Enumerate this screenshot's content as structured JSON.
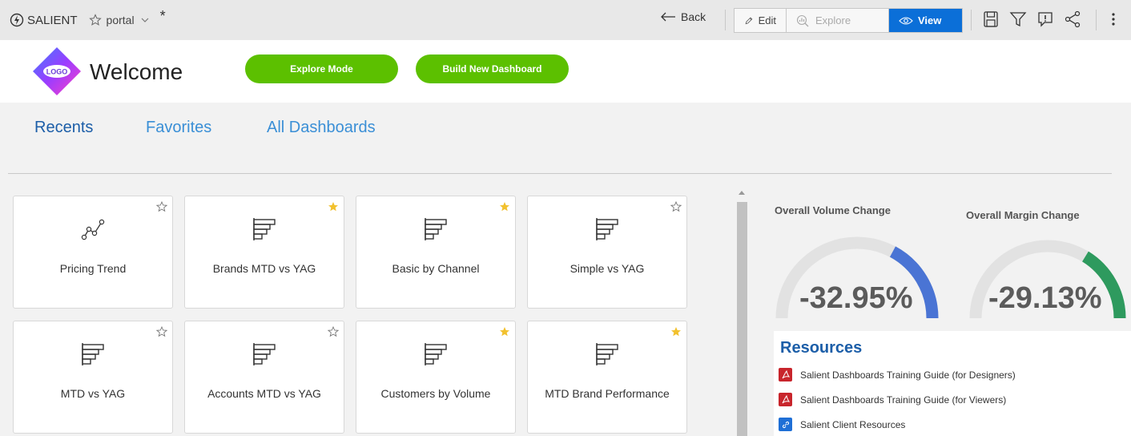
{
  "toolbar": {
    "brand": "SALIENT",
    "portal": "portal",
    "modified_marker": "*",
    "back": "Back",
    "edit": "Edit",
    "explore": "Explore",
    "view": "View"
  },
  "header": {
    "logo_text": "LOGO",
    "title": "Welcome",
    "explore_mode": "Explore Mode",
    "build_dashboard": "Build New Dashboard"
  },
  "tabs": {
    "recents": "Recents",
    "favorites": "Favorites",
    "all": "All Dashboards"
  },
  "cards": [
    {
      "label": "Pricing Trend",
      "icon": "line-chart-icon",
      "favorite": false
    },
    {
      "label": "Brands MTD vs YAG",
      "icon": "bar-chart-icon",
      "favorite": true
    },
    {
      "label": "Basic by Channel",
      "icon": "bar-chart-icon",
      "favorite": true
    },
    {
      "label": "Simple vs YAG",
      "icon": "bar-chart-icon",
      "favorite": false
    },
    {
      "label": "MTD vs YAG",
      "icon": "bar-chart-icon",
      "favorite": false
    },
    {
      "label": "Accounts MTD vs YAG",
      "icon": "bar-chart-icon",
      "favorite": false
    },
    {
      "label": "Customers by Volume",
      "icon": "bar-chart-icon",
      "favorite": true
    },
    {
      "label": "MTD Brand Performance",
      "icon": "bar-chart-icon",
      "favorite": true
    }
  ],
  "gauges": {
    "volume": {
      "title": "Overall Volume Change",
      "value": "-32.95%",
      "color": "#4a74d4"
    },
    "margin": {
      "title": "Overall Margin Change",
      "value": "-29.13%",
      "color": "#2e9a5e"
    }
  },
  "resources": {
    "title": "Resources",
    "items": [
      {
        "label": "Salient Dashboards Training Guide (for Designers)",
        "icon": "pdf-icon"
      },
      {
        "label": "Salient Dashboards Training Guide (for Viewers)",
        "icon": "pdf-icon"
      },
      {
        "label": "Salient Client Resources",
        "icon": "link-icon"
      }
    ]
  },
  "colors": {
    "accent_blue": "#0b6fd8",
    "tab_blue": "#3a8fd6",
    "green_button": "#5cc000",
    "star_gold": "#f2c12e",
    "pdf_red": "#c8252c"
  }
}
